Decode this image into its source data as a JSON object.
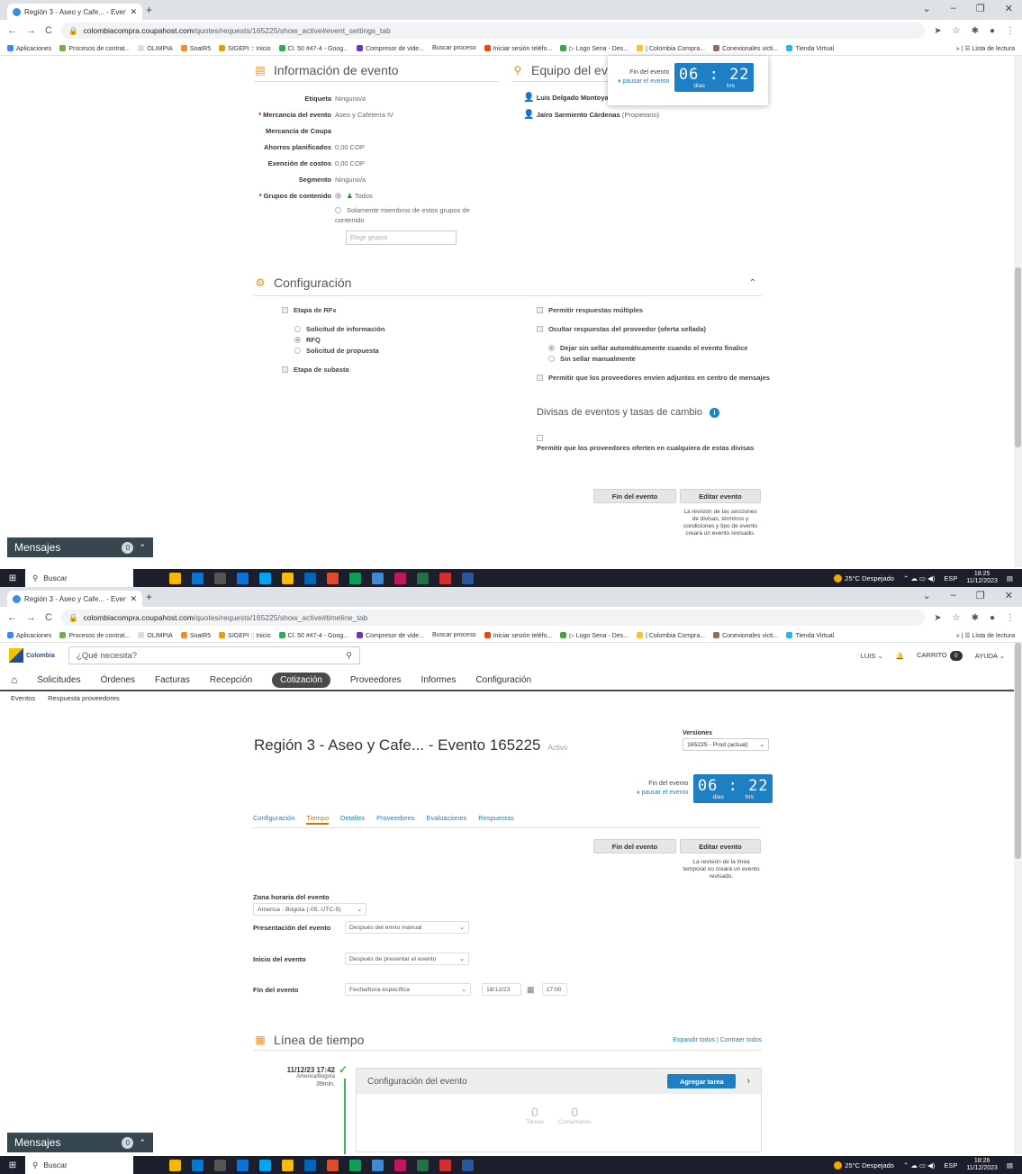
{
  "browser": {
    "tab_title": "Región 3 - Aseo y Cafe... - Event",
    "url_host": "colombiacompra.coupahost.com",
    "url_path_1": "/quotes/requests/165225/show_active#event_settings_tab",
    "url_path_2": "/quotes/requests/165225/show_active#timeline_tab",
    "bookmarks": [
      "Aplicaciones",
      "Procesos de contrat...",
      "OLIMPIA",
      "SoatR5",
      "SIGEPI :: Inicio",
      "Cl. 50 #47-4 - Goog...",
      "Compresor de vide...",
      "Buscar proceso",
      "Iniciar sesión teléfo...",
      "▷ Logo Sena - Des...",
      "| Colombia Compra...",
      "Conexionales victi...",
      "Tienda Virtual"
    ],
    "reading_list": "Lista de lectura"
  },
  "taskbar": {
    "search": "Buscar",
    "weather": "25°C Despejado",
    "lang": "ESP",
    "time_1": "18:25",
    "time_2": "18:26",
    "date": "11/12/2023"
  },
  "messages": {
    "label": "Mensajes",
    "count": "0"
  },
  "timer": {
    "end_label": "Fin del evento",
    "pause_label": "pausar el evento",
    "digits": "06 : 22",
    "unit_days": "días",
    "unit_hrs": "hrs"
  },
  "info": {
    "title": "Información de evento",
    "fields": [
      {
        "label": "Etiqueta",
        "value": "Ninguno/a",
        "required": false
      },
      {
        "label": "Mercancía del evento",
        "value": "Aseo y Cafetería IV",
        "required": true
      },
      {
        "label": "Mercancía de Coupa",
        "value": "",
        "required": false
      },
      {
        "label": "Ahorros planificados",
        "value": "0,00 COP",
        "required": false
      },
      {
        "label": "Exención de costos",
        "value": "0,00 COP",
        "required": false
      },
      {
        "label": "Segmento",
        "value": "Ninguno/a",
        "required": false
      }
    ],
    "groups_label": "Grupos de contenido",
    "groups_all": "Todos",
    "groups_only": "Solamente miembros de estos grupos de contenido",
    "groups_placeholder": "Elegir grupos"
  },
  "team": {
    "title": "Equipo del eve",
    "members": [
      {
        "name": "Luis Delgado Montoya",
        "role": ""
      },
      {
        "name": "Jairo Sarmiento Cárdenas",
        "role": "(Propietario)"
      }
    ]
  },
  "config": {
    "title": "Configuración",
    "rfx_stage": "Etapa de RFx",
    "rfx_options": [
      "Solicitud de información",
      "RFQ",
      "Solicitud de propuesta"
    ],
    "auction_stage": "Etapa de subasta",
    "multi_responses": "Permitir respuestas múltiples",
    "hide_responses": "Ocultar respuestas del proveedor (oferta sellada)",
    "unseal_auto": "Dejar sin sellar automáticamente cuando el evento finalice",
    "unseal_manual": "Sin sellar manualmente",
    "allow_attachments": "Permitir que los proveedores envíen adjuntos en centro de mensajes",
    "currency_title": "Divisas de eventos y tasas de cambio",
    "currency_allow": "Permitir que los proveedores oferten en cualquiera de estas divisas"
  },
  "actions": {
    "end_event": "Fin del evento",
    "edit_event": "Editar evento",
    "note_1": "La revisión de las secciones de divisas, términos y condiciones y tipo de evento creará un evento revisado.",
    "note_2": "La revisión de la línea temporal no creará un evento revisado."
  },
  "app": {
    "search_placeholder": "¿Qué necesita?",
    "logo_text": "Colombia",
    "user": "LUIS",
    "cart": "CARRITO",
    "cart_count": "0",
    "help": "AYUDA",
    "nav": [
      "Solicitudes",
      "Órdenes",
      "Facturas",
      "Recepción",
      "Cotización",
      "Proveedores",
      "Informes",
      "Configuración"
    ],
    "subnav": [
      "Eventos",
      "Respuesta proveedores"
    ]
  },
  "event": {
    "title": "Región 3 - Aseo y Cafe... - Evento 165225",
    "status": "Activo",
    "versions_label": "Versiones",
    "version_value": "165225 - Prod (actual)",
    "tabs": [
      "Configuración",
      "Tiempo",
      "Detalles",
      "Proveedores",
      "Evaluaciones",
      "Respuestas"
    ],
    "active_tab": "Tiempo"
  },
  "timing": {
    "tz_label": "Zona horaria del evento",
    "tz_value": "America - Bogota (-05, UTC-5)",
    "presentation_label": "Presentación del evento",
    "presentation_value": "Después del envío manual",
    "start_label": "Inicio del evento",
    "start_value": "Después de presentar el evento",
    "end_label": "Fin del evento",
    "end_value": "Fecha/hora específica",
    "end_date": "18/12/23",
    "end_time": "17:00"
  },
  "timeline": {
    "title": "Línea de tiempo",
    "expand": "Expandir todos",
    "collapse": "Contraer todos",
    "entry_time": "11/12/23 17:42",
    "entry_tz": "America/Bogota",
    "entry_dur": "39min.",
    "card_title": "Configuración del evento",
    "add_task": "Agregar tarea",
    "tasks_count": "0",
    "tasks_label": "Tareas",
    "comments_count": "0",
    "comments_label": "Comentarios"
  }
}
